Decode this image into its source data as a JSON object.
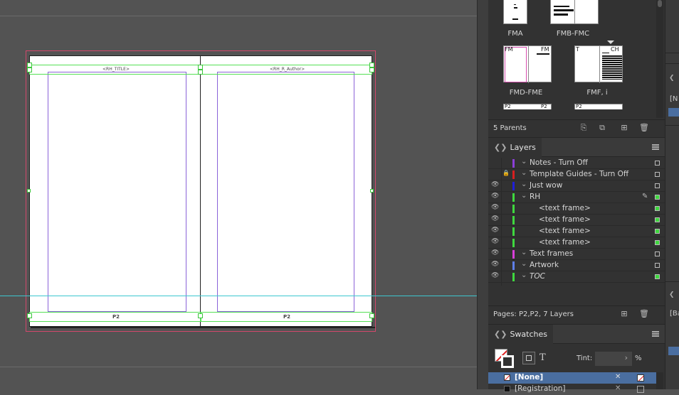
{
  "document": {
    "left_running_head": "<RH_TITLE>",
    "right_running_head": "<RH_R_Author>",
    "left_folio": "P2",
    "right_folio": "P2"
  },
  "pages_panel": {
    "thumbnails": [
      {
        "label": "FMA"
      },
      {
        "label": "FMB-FMC"
      },
      {
        "label": "FMD-FME",
        "page_marks": [
          "FM",
          "FM"
        ]
      },
      {
        "label": "FMF, i",
        "page_marks": [
          "T",
          "CH"
        ]
      }
    ],
    "bottom_row_marks": [
      "P2",
      "P2",
      "P2"
    ],
    "footer_text": "5 Parents"
  },
  "layers_panel": {
    "tab_label": "Layers",
    "layers": [
      {
        "name": "Notes - Turn Off",
        "color": "#8b3fd8",
        "visible": false,
        "locked": false,
        "indent": 0
      },
      {
        "name": "Template Guides - Turn Off",
        "color": "#d81f1f",
        "visible": false,
        "locked": true,
        "indent": 0
      },
      {
        "name": "Just wow",
        "color": "#1f1fd8",
        "visible": true,
        "locked": false,
        "indent": 0
      },
      {
        "name": "RH",
        "color": "#3fd83f",
        "visible": true,
        "locked": false,
        "indent": 0,
        "pen": true
      },
      {
        "name": "<text frame>",
        "color": "#3fd83f",
        "visible": true,
        "locked": false,
        "indent": 1
      },
      {
        "name": "<text frame>",
        "color": "#3fd83f",
        "visible": true,
        "locked": false,
        "indent": 1
      },
      {
        "name": "<text frame>",
        "color": "#3fd83f",
        "visible": true,
        "locked": false,
        "indent": 1
      },
      {
        "name": "<text frame>",
        "color": "#3fd83f",
        "visible": true,
        "locked": false,
        "indent": 1
      },
      {
        "name": "Text frames",
        "color": "#d83fd8",
        "visible": true,
        "locked": false,
        "indent": 0
      },
      {
        "name": "Artwork",
        "color": "#5f7fe8",
        "visible": true,
        "locked": false,
        "indent": 0
      },
      {
        "name": "TOC",
        "color": "#3fd83f",
        "visible": true,
        "locked": false,
        "indent": 0,
        "italic": true
      }
    ],
    "footer_text": "Pages: P2,P2, 7 Layers"
  },
  "swatches_panel": {
    "tab_label": "Swatches",
    "tint_label": "Tint:",
    "tint_value": "",
    "tint_unit": "%",
    "text_icon": "T",
    "swatches": [
      {
        "name": "[None]",
        "selected": true
      },
      {
        "name": "[Registration]",
        "selected": false
      }
    ]
  },
  "dock": {
    "marks": [
      "[N",
      "[Ba"
    ]
  },
  "colors": {
    "selection_green": "#55e055",
    "margin_purple": "#8b63d8",
    "bleed_red": "#d2476b",
    "guide_cyan": "#3cc7cf",
    "selected_row": "#4a6ea0"
  }
}
